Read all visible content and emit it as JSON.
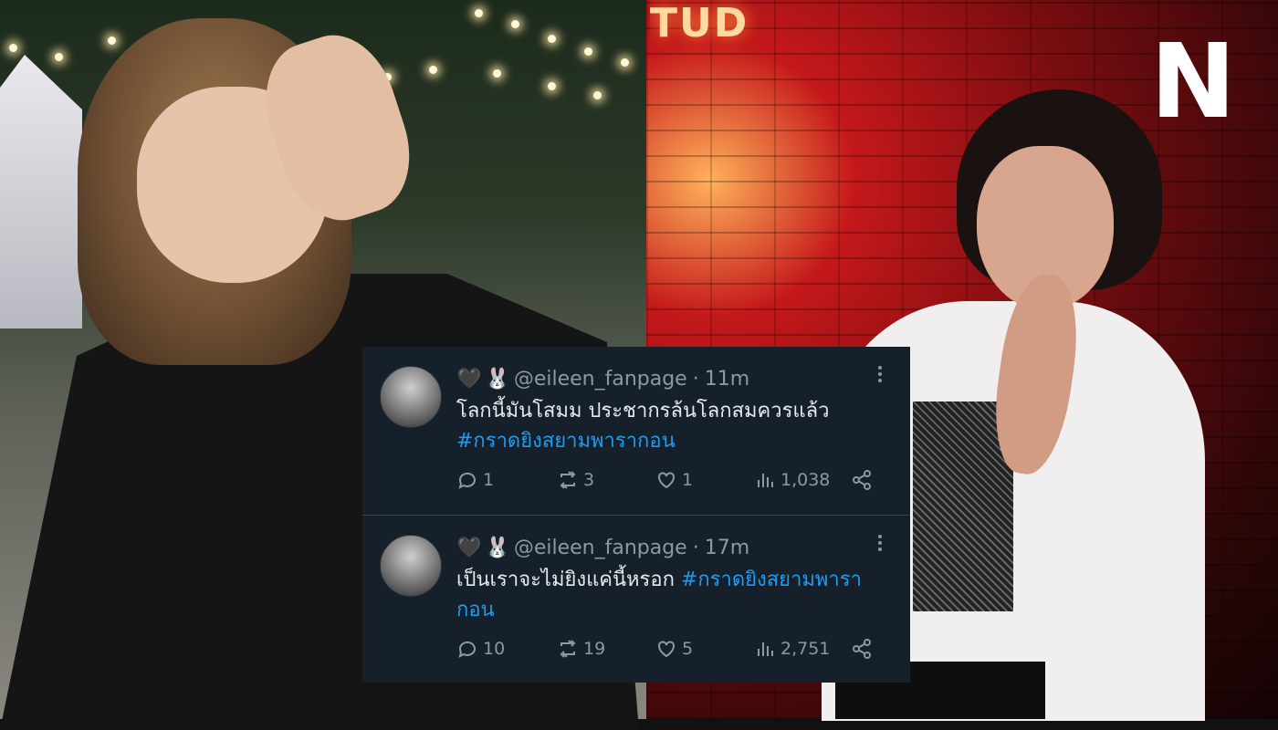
{
  "logo": {
    "text": "N"
  },
  "background": {
    "neon_text": "TUD"
  },
  "tweets": [
    {
      "emoji_1": "🖤",
      "emoji_2": "🐰",
      "handle": "@eileen_fanpage",
      "separator": "·",
      "time": "11m",
      "text": "โลกนี้มันโสมม ประชากรล้นโลกสมควรแล้ว",
      "hashtag": "#กราดยิงสยามพารากอน",
      "replies": "1",
      "retweets": "3",
      "likes": "1",
      "views": "1,038"
    },
    {
      "emoji_1": "🖤",
      "emoji_2": "🐰",
      "handle": "@eileen_fanpage",
      "separator": "·",
      "time": "17m",
      "text": "เป็นเราจะไม่ยิงแค่นี้หรอก ",
      "hashtag": "#กราดยิงสยามพารากอน",
      "replies": "10",
      "retweets": "19",
      "likes": "5",
      "views": "2,751"
    }
  ],
  "colors": {
    "card_bg": "#15202b",
    "text": "#e7e9ea",
    "muted": "#8b98a5",
    "link": "#1d9bf0",
    "logo": "#ffffff"
  },
  "icons": [
    "reply-icon",
    "retweet-icon",
    "like-icon",
    "views-icon",
    "share-icon",
    "more-icon"
  ]
}
